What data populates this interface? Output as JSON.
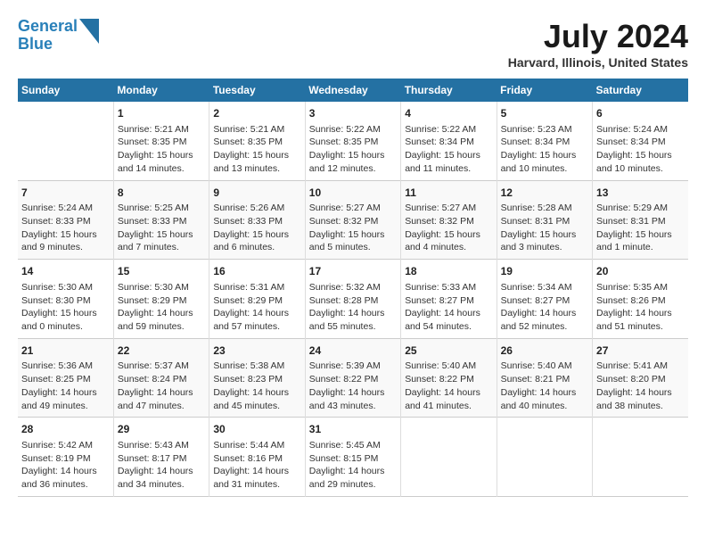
{
  "header": {
    "logo_line1": "General",
    "logo_line2": "Blue",
    "month_title": "July 2024",
    "location": "Harvard, Illinois, United States"
  },
  "days_of_week": [
    "Sunday",
    "Monday",
    "Tuesday",
    "Wednesday",
    "Thursday",
    "Friday",
    "Saturday"
  ],
  "weeks": [
    [
      {
        "num": "",
        "info": ""
      },
      {
        "num": "1",
        "info": "Sunrise: 5:21 AM\nSunset: 8:35 PM\nDaylight: 15 hours\nand 14 minutes."
      },
      {
        "num": "2",
        "info": "Sunrise: 5:21 AM\nSunset: 8:35 PM\nDaylight: 15 hours\nand 13 minutes."
      },
      {
        "num": "3",
        "info": "Sunrise: 5:22 AM\nSunset: 8:35 PM\nDaylight: 15 hours\nand 12 minutes."
      },
      {
        "num": "4",
        "info": "Sunrise: 5:22 AM\nSunset: 8:34 PM\nDaylight: 15 hours\nand 11 minutes."
      },
      {
        "num": "5",
        "info": "Sunrise: 5:23 AM\nSunset: 8:34 PM\nDaylight: 15 hours\nand 10 minutes."
      },
      {
        "num": "6",
        "info": "Sunrise: 5:24 AM\nSunset: 8:34 PM\nDaylight: 15 hours\nand 10 minutes."
      }
    ],
    [
      {
        "num": "7",
        "info": "Sunrise: 5:24 AM\nSunset: 8:33 PM\nDaylight: 15 hours\nand 9 minutes."
      },
      {
        "num": "8",
        "info": "Sunrise: 5:25 AM\nSunset: 8:33 PM\nDaylight: 15 hours\nand 7 minutes."
      },
      {
        "num": "9",
        "info": "Sunrise: 5:26 AM\nSunset: 8:33 PM\nDaylight: 15 hours\nand 6 minutes."
      },
      {
        "num": "10",
        "info": "Sunrise: 5:27 AM\nSunset: 8:32 PM\nDaylight: 15 hours\nand 5 minutes."
      },
      {
        "num": "11",
        "info": "Sunrise: 5:27 AM\nSunset: 8:32 PM\nDaylight: 15 hours\nand 4 minutes."
      },
      {
        "num": "12",
        "info": "Sunrise: 5:28 AM\nSunset: 8:31 PM\nDaylight: 15 hours\nand 3 minutes."
      },
      {
        "num": "13",
        "info": "Sunrise: 5:29 AM\nSunset: 8:31 PM\nDaylight: 15 hours\nand 1 minute."
      }
    ],
    [
      {
        "num": "14",
        "info": "Sunrise: 5:30 AM\nSunset: 8:30 PM\nDaylight: 15 hours\nand 0 minutes."
      },
      {
        "num": "15",
        "info": "Sunrise: 5:30 AM\nSunset: 8:29 PM\nDaylight: 14 hours\nand 59 minutes."
      },
      {
        "num": "16",
        "info": "Sunrise: 5:31 AM\nSunset: 8:29 PM\nDaylight: 14 hours\nand 57 minutes."
      },
      {
        "num": "17",
        "info": "Sunrise: 5:32 AM\nSunset: 8:28 PM\nDaylight: 14 hours\nand 55 minutes."
      },
      {
        "num": "18",
        "info": "Sunrise: 5:33 AM\nSunset: 8:27 PM\nDaylight: 14 hours\nand 54 minutes."
      },
      {
        "num": "19",
        "info": "Sunrise: 5:34 AM\nSunset: 8:27 PM\nDaylight: 14 hours\nand 52 minutes."
      },
      {
        "num": "20",
        "info": "Sunrise: 5:35 AM\nSunset: 8:26 PM\nDaylight: 14 hours\nand 51 minutes."
      }
    ],
    [
      {
        "num": "21",
        "info": "Sunrise: 5:36 AM\nSunset: 8:25 PM\nDaylight: 14 hours\nand 49 minutes."
      },
      {
        "num": "22",
        "info": "Sunrise: 5:37 AM\nSunset: 8:24 PM\nDaylight: 14 hours\nand 47 minutes."
      },
      {
        "num": "23",
        "info": "Sunrise: 5:38 AM\nSunset: 8:23 PM\nDaylight: 14 hours\nand 45 minutes."
      },
      {
        "num": "24",
        "info": "Sunrise: 5:39 AM\nSunset: 8:22 PM\nDaylight: 14 hours\nand 43 minutes."
      },
      {
        "num": "25",
        "info": "Sunrise: 5:40 AM\nSunset: 8:22 PM\nDaylight: 14 hours\nand 41 minutes."
      },
      {
        "num": "26",
        "info": "Sunrise: 5:40 AM\nSunset: 8:21 PM\nDaylight: 14 hours\nand 40 minutes."
      },
      {
        "num": "27",
        "info": "Sunrise: 5:41 AM\nSunset: 8:20 PM\nDaylight: 14 hours\nand 38 minutes."
      }
    ],
    [
      {
        "num": "28",
        "info": "Sunrise: 5:42 AM\nSunset: 8:19 PM\nDaylight: 14 hours\nand 36 minutes."
      },
      {
        "num": "29",
        "info": "Sunrise: 5:43 AM\nSunset: 8:17 PM\nDaylight: 14 hours\nand 34 minutes."
      },
      {
        "num": "30",
        "info": "Sunrise: 5:44 AM\nSunset: 8:16 PM\nDaylight: 14 hours\nand 31 minutes."
      },
      {
        "num": "31",
        "info": "Sunrise: 5:45 AM\nSunset: 8:15 PM\nDaylight: 14 hours\nand 29 minutes."
      },
      {
        "num": "",
        "info": ""
      },
      {
        "num": "",
        "info": ""
      },
      {
        "num": "",
        "info": ""
      }
    ]
  ]
}
